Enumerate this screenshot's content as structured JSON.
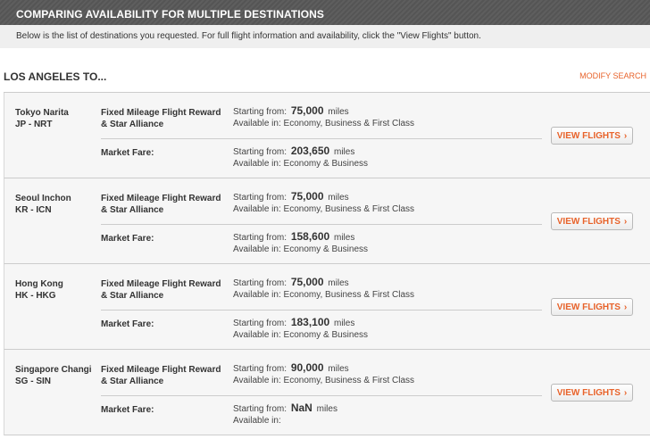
{
  "header": {
    "title": "COMPARING AVAILABILITY FOR MULTIPLE DESTINATIONS",
    "subtitle": "Below is the list of destinations you requested. For full flight information and availability, click the \"View Flights\" button."
  },
  "section": {
    "title": "LOS ANGELES TO...",
    "modify_label": "MODIFY SEARCH"
  },
  "labels": {
    "reward_line1": "Fixed Mileage Flight Reward",
    "reward_line2": "& Star Alliance",
    "market": "Market Fare:",
    "starting_from": "Starting from:",
    "miles": "miles",
    "available_in": "Available in:",
    "view_flights": "VIEW FLIGHTS",
    "chevron": "›"
  },
  "destinations": [
    {
      "city": "Tokyo Narita",
      "code": "JP - NRT",
      "reward_miles": "75,000",
      "reward_classes": "Economy, Business & First Class",
      "market_miles": "203,650",
      "market_classes": "Economy & Business"
    },
    {
      "city": "Seoul Inchon",
      "code": "KR - ICN",
      "reward_miles": "75,000",
      "reward_classes": "Economy, Business & First Class",
      "market_miles": "158,600",
      "market_classes": "Economy & Business"
    },
    {
      "city": "Hong Kong",
      "code": "HK - HKG",
      "reward_miles": "75,000",
      "reward_classes": "Economy, Business & First Class",
      "market_miles": "183,100",
      "market_classes": "Economy & Business"
    },
    {
      "city": "Singapore Changi",
      "code": "SG - SIN",
      "reward_miles": "90,000",
      "reward_classes": "Economy, Business & First Class",
      "market_miles": "NaN",
      "market_classes": ""
    }
  ]
}
